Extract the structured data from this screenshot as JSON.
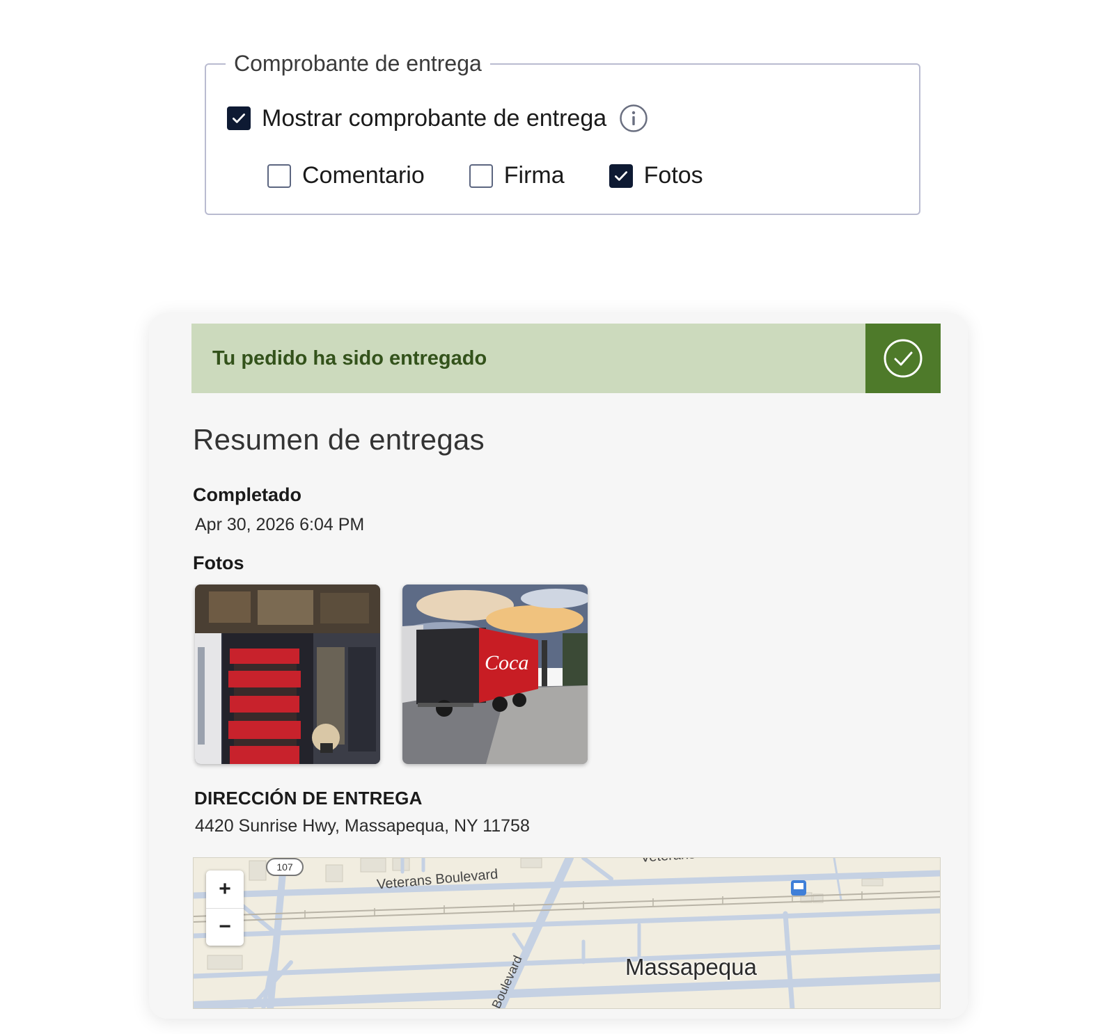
{
  "proof": {
    "legend": "Comprobante de entrega",
    "show": {
      "label": "Mostrar comprobante de entrega",
      "checked": true
    },
    "options": [
      {
        "label": "Comentario",
        "checked": false
      },
      {
        "label": "Firma",
        "checked": false
      },
      {
        "label": "Fotos",
        "checked": true
      }
    ]
  },
  "card": {
    "banner": "Tu pedido ha sido entregado",
    "title": "Resumen de entregas",
    "completed_label": "Completado",
    "completed_value": "Apr 30, 2026 6:04 PM",
    "photos_label": "Fotos",
    "address_label": "DIRECCIÓN DE ENTREGA",
    "address_value": "4420 Sunrise Hwy, Massapequa, NY 11758"
  },
  "map": {
    "road_1": "Veterans Boulevard",
    "road_2": "Boulevard",
    "road_3": "Veterans",
    "route": "107",
    "town": "Massapequa",
    "zoom_in": "+",
    "zoom_out": "−"
  },
  "colors": {
    "banner_bg": "#ccdabd",
    "banner_text": "#33521b",
    "banner_check": "#4e7a2a",
    "checkbox_checked": "#0e1a33"
  }
}
